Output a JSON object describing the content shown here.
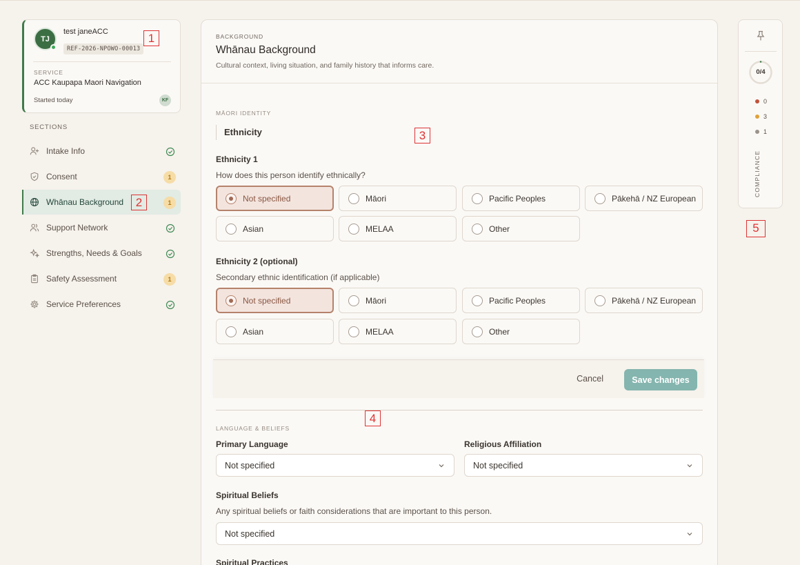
{
  "profile": {
    "initials": "TJ",
    "name": "test janeACC",
    "reference": "REF-2026-NPOWO-00013",
    "service_label": "SERVICE",
    "service_name": "ACC Kaupapa Maori Navigation",
    "started": "Started today",
    "assignee_initials": "KF"
  },
  "sidebar": {
    "title": "SECTIONS",
    "items": [
      {
        "label": "Intake Info",
        "icon": "user-plus-icon",
        "status": "complete"
      },
      {
        "label": "Consent",
        "icon": "shield-check-icon",
        "status": "badge",
        "badge": "1"
      },
      {
        "label": "Whānau Background",
        "icon": "globe-icon",
        "status": "badge",
        "badge": "1",
        "active": true
      },
      {
        "label": "Support Network",
        "icon": "users-icon",
        "status": "complete"
      },
      {
        "label": "Strengths, Needs & Goals",
        "icon": "sparkles-icon",
        "status": "complete"
      },
      {
        "label": "Safety Assessment",
        "icon": "clipboard-icon",
        "status": "badge",
        "badge": "1"
      },
      {
        "label": "Service Preferences",
        "icon": "gear-icon",
        "status": "complete"
      }
    ]
  },
  "main": {
    "kicker": "BACKGROUND",
    "title": "Whānau Background",
    "subtitle": "Cultural context, living situation, and family history that informs care.",
    "identity_section": "MĀORI IDENTITY",
    "ethnicity_subhead": "Ethnicity",
    "ethnicity1": {
      "title": "Ethnicity 1",
      "help": "How does this person identify ethnically?",
      "options": [
        "Not specified",
        "Māori",
        "Pacific Peoples",
        "Pākehā / NZ European",
        "Asian",
        "MELAA",
        "Other"
      ],
      "selected": "Not specified"
    },
    "ethnicity2": {
      "title": "Ethnicity 2 (optional)",
      "help": "Secondary ethnic identification (if applicable)",
      "options": [
        "Not specified",
        "Māori",
        "Pacific Peoples",
        "Pākehā / NZ European",
        "Asian",
        "MELAA",
        "Other"
      ],
      "selected": "Not specified"
    },
    "actions": {
      "cancel": "Cancel",
      "save": "Save changes"
    },
    "language_section": "LANGUAGE & BELIEFS",
    "primary_language": {
      "label": "Primary Language",
      "value": "Not specified"
    },
    "religious_affiliation": {
      "label": "Religious Affiliation",
      "value": "Not specified"
    },
    "spiritual_beliefs": {
      "label": "Spiritual Beliefs",
      "help": "Any spiritual beliefs or faith considerations that are important to this person.",
      "value": "Not specified"
    },
    "spiritual_practices": {
      "label": "Spiritual Practices"
    }
  },
  "rail": {
    "progress": "0/4",
    "progress_fraction": 0.0,
    "counts": [
      {
        "value": "0",
        "color": "#c0533a"
      },
      {
        "value": "3",
        "color": "#e0a23a"
      },
      {
        "value": "1",
        "color": "#9a938c"
      }
    ],
    "label": "COMPLIANCE"
  },
  "markers": [
    "1",
    "2",
    "3",
    "4",
    "5"
  ],
  "colors": {
    "accent_green": "#3f7a4a",
    "selected_border": "#b5826b",
    "save_button": "#84b5ae"
  }
}
